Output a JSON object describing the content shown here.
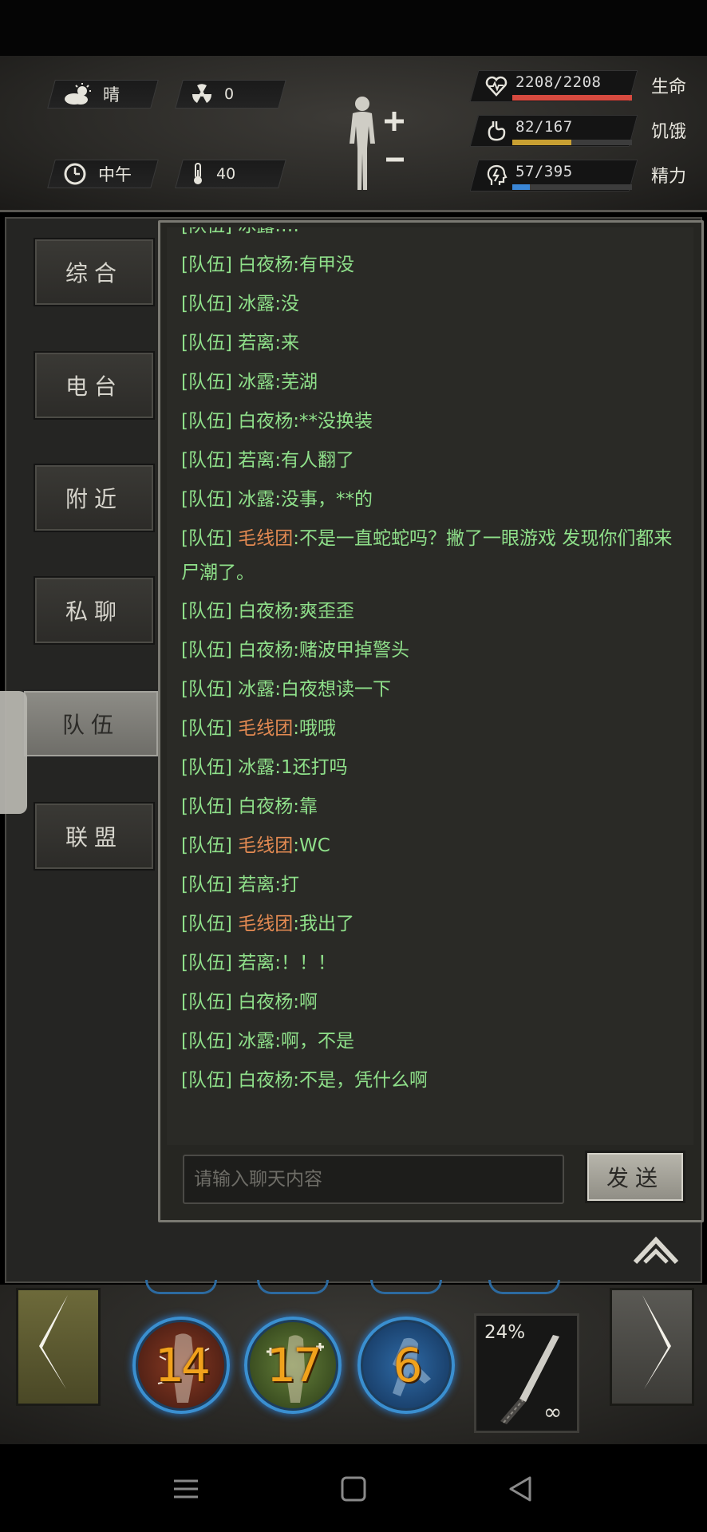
{
  "environment": {
    "weather_label": "晴",
    "radiation_value": "0",
    "time_label": "中午",
    "temperature_value": "40"
  },
  "stats": [
    {
      "value": "2208/2208",
      "label": "生命",
      "fill": 1.0,
      "color": "#d64a3f",
      "icon": "heart-icon"
    },
    {
      "value": "82/167",
      "label": "饥饿",
      "fill": 0.49,
      "color": "#c9a032",
      "icon": "stomach-icon"
    },
    {
      "value": "57/395",
      "label": "精力",
      "fill": 0.144,
      "color": "#3a86d6",
      "icon": "energy-head-icon"
    }
  ],
  "tabs": [
    {
      "label": "综合"
    },
    {
      "label": "电台"
    },
    {
      "label": "附近"
    },
    {
      "label": "私聊"
    },
    {
      "label": "队伍"
    },
    {
      "label": "联盟"
    }
  ],
  "active_tab": "队伍",
  "chat": {
    "partial_top": "[队伍] 冰露:…",
    "messages": [
      {
        "channel": "[队伍]",
        "sender": "白夜杨",
        "text": ":有甲没",
        "orange": false
      },
      {
        "channel": "[队伍]",
        "sender": "冰露",
        "text": ":没",
        "orange": false
      },
      {
        "channel": "[队伍]",
        "sender": "若离",
        "text": ":来",
        "orange": false
      },
      {
        "channel": "[队伍]",
        "sender": "冰露",
        "text": ":芜湖",
        "orange": false
      },
      {
        "channel": "[队伍]",
        "sender": "白夜杨",
        "text": ":**没换装",
        "orange": false
      },
      {
        "channel": "[队伍]",
        "sender": "若离",
        "text": ":有人翻了",
        "orange": false
      },
      {
        "channel": "[队伍]",
        "sender": "冰露",
        "text": ":没事，**的",
        "orange": false
      },
      {
        "channel": "[队伍]",
        "sender": "毛线团",
        "text": ":不是一直蛇蛇吗？撇了一眼游戏 发现你们都来尸潮了。",
        "orange": true
      },
      {
        "channel": "[队伍]",
        "sender": "白夜杨",
        "text": ":爽歪歪",
        "orange": false
      },
      {
        "channel": "[队伍]",
        "sender": "白夜杨",
        "text": ":赌波甲掉警头",
        "orange": false
      },
      {
        "channel": "[队伍]",
        "sender": "冰露",
        "text": ":白夜想读一下",
        "orange": false
      },
      {
        "channel": "[队伍]",
        "sender": "毛线团",
        "text": ":哦哦",
        "orange": true
      },
      {
        "channel": "[队伍]",
        "sender": "冰露",
        "text": ":1还打吗",
        "orange": false
      },
      {
        "channel": "[队伍]",
        "sender": "白夜杨",
        "text": ":靠",
        "orange": false
      },
      {
        "channel": "[队伍]",
        "sender": "毛线团",
        "text": ":WC",
        "orange": true
      },
      {
        "channel": "[队伍]",
        "sender": "若离",
        "text": ":打",
        "orange": false
      },
      {
        "channel": "[队伍]",
        "sender": "毛线团",
        "text": ":我出了",
        "orange": true
      },
      {
        "channel": "[队伍]",
        "sender": "若离",
        "text": ":！！！",
        "orange": false
      },
      {
        "channel": "[队伍]",
        "sender": "白夜杨",
        "text": ":啊",
        "orange": false
      },
      {
        "channel": "[队伍]",
        "sender": "冰露",
        "text": ":啊，不是",
        "orange": false
      },
      {
        "channel": "[队伍]",
        "sender": "白夜杨",
        "text": ":不是，凭什么啊",
        "orange": false
      }
    ],
    "input_placeholder": "请输入聊天内容",
    "send_label": "发送"
  },
  "skills": [
    {
      "value": "14",
      "icon": "injury-body-icon"
    },
    {
      "value": "17",
      "icon": "heal-body-icon"
    },
    {
      "value": "6",
      "icon": "running-figure-icon"
    }
  ],
  "weapon": {
    "durability": "24%",
    "ammo": "∞",
    "icon": "machete-icon"
  },
  "colors": {
    "chat_green": "#8fe08a",
    "sender_orange": "#e38a52",
    "skill_ring_blue": "#3a8fd0",
    "skill_number_orange": "#f0a21c"
  }
}
